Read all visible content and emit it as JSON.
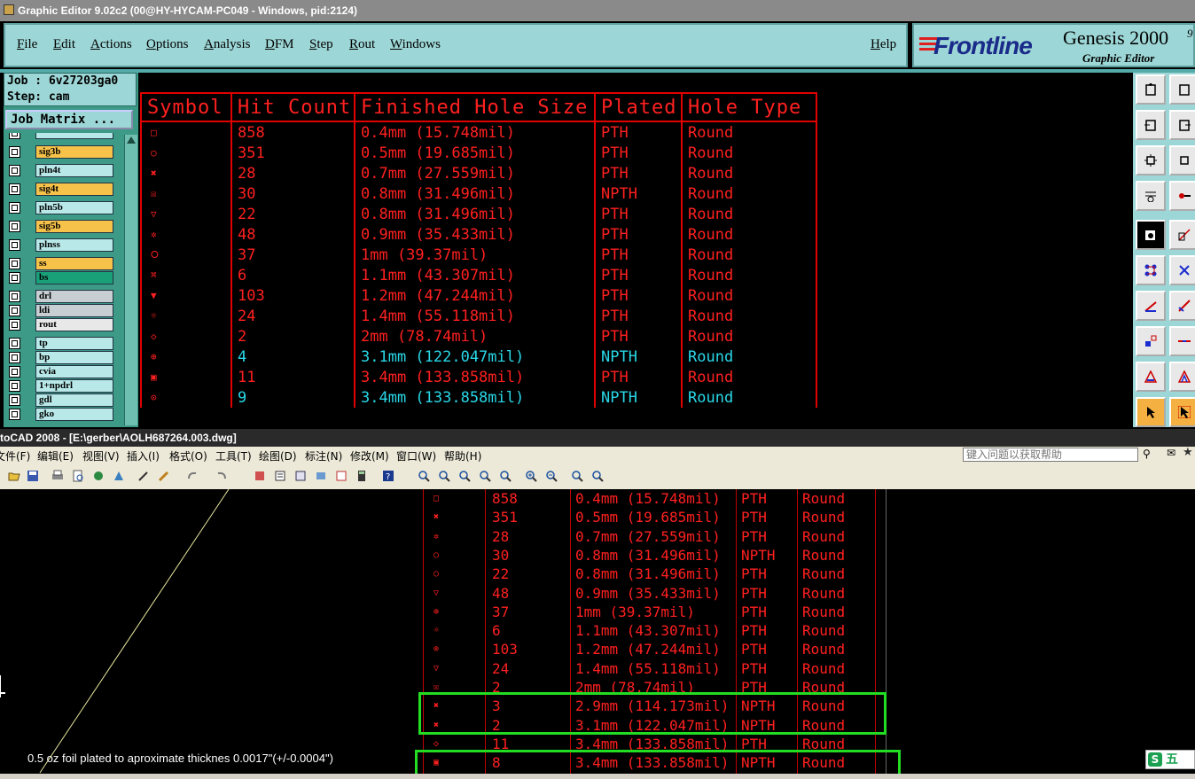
{
  "genesis": {
    "title": "Graphic Editor 9.02c2 (00@HY-HYCAM-PC049 - Windows, pid:2124)",
    "menu": [
      "File",
      "Edit",
      "Actions",
      "Options",
      "Analysis",
      "DFM",
      "Step",
      "Rout",
      "Windows"
    ],
    "help": "Help",
    "brand": {
      "logo": "Frontline",
      "product": "Genesis 2000",
      "version_fragment": "9",
      "subtitle": "Graphic Editor"
    },
    "job": "Job : 6v27203ga0",
    "step": "Step: cam",
    "job_matrix": "Job Matrix ...",
    "layers": [
      {
        "name": "",
        "color": "#b8e8e8"
      },
      {
        "name": "sig3b",
        "color": "#f6c24a"
      },
      {
        "name": "pln4t",
        "color": "#b8e8e8"
      },
      {
        "name": "sig4t",
        "color": "#f6c24a"
      },
      {
        "name": "pln5b",
        "color": "#b8e8e8"
      },
      {
        "name": "sig5b",
        "color": "#f6c24a"
      },
      {
        "name": "plnss",
        "color": "#b8e8e8"
      },
      {
        "name": "ss",
        "color": "#f6c24a"
      },
      {
        "name": "bs",
        "color": "#1aa078"
      },
      {
        "name": "drl",
        "color": "#c8cfd2"
      },
      {
        "name": "ldi",
        "color": "#c8cfd2"
      },
      {
        "name": "rout",
        "color": "#e8e8e8"
      },
      {
        "name": "tp",
        "color": "#b8e8e8"
      },
      {
        "name": "bp",
        "color": "#b8e8e8"
      },
      {
        "name": "cvia",
        "color": "#b8e8e8"
      },
      {
        "name": "1+npdrl",
        "color": "#b8e8e8"
      },
      {
        "name": "gdl",
        "color": "#b8e8e8"
      },
      {
        "name": "gko",
        "color": "#b8e8e8"
      }
    ],
    "table": {
      "headers": [
        "Symbol",
        "Hit Count",
        "Finished Hole Size",
        "Plated",
        "Hole Type"
      ],
      "rows": [
        {
          "sym": "□",
          "count": "858",
          "size": "0.4mm (15.748mil)",
          "plated": "PTH",
          "type": "Round",
          "cyan": false
        },
        {
          "sym": "○",
          "count": "351",
          "size": "0.5mm (19.685mil)",
          "plated": "PTH",
          "type": "Round",
          "cyan": false
        },
        {
          "sym": "✖",
          "count": "28",
          "size": "0.7mm (27.559mil)",
          "plated": "PTH",
          "type": "Round",
          "cyan": false
        },
        {
          "sym": "☒",
          "count": "30",
          "size": "0.8mm (31.496mil)",
          "plated": "NPTH",
          "type": "Round",
          "cyan": false
        },
        {
          "sym": "▽",
          "count": "22",
          "size": "0.8mm (31.496mil)",
          "plated": "PTH",
          "type": "Round",
          "cyan": false
        },
        {
          "sym": "✲",
          "count": "48",
          "size": "0.9mm (35.433mil)",
          "plated": "PTH",
          "type": "Round",
          "cyan": false
        },
        {
          "sym": "⭘",
          "count": "37",
          "size": "1mm (39.37mil)",
          "plated": "PTH",
          "type": "Round",
          "cyan": false
        },
        {
          "sym": "⌘",
          "count": "6",
          "size": "1.1mm (43.307mil)",
          "plated": "PTH",
          "type": "Round",
          "cyan": false
        },
        {
          "sym": "▼",
          "count": "103",
          "size": "1.2mm (47.244mil)",
          "plated": "PTH",
          "type": "Round",
          "cyan": false
        },
        {
          "sym": "☼",
          "count": "24",
          "size": "1.4mm (55.118mil)",
          "plated": "PTH",
          "type": "Round",
          "cyan": false
        },
        {
          "sym": "◇",
          "count": "2",
          "size": "2mm (78.74mil)",
          "plated": "PTH",
          "type": "Round",
          "cyan": false
        },
        {
          "sym": "⊕",
          "count": "4",
          "size": "3.1mm (122.047mil)",
          "plated": "NPTH",
          "type": "Round",
          "cyan": true
        },
        {
          "sym": "▣",
          "count": "11",
          "size": "3.4mm (133.858mil)",
          "plated": "PTH",
          "type": "Round",
          "cyan": false
        },
        {
          "sym": "⊙",
          "count": "9",
          "size": "3.4mm (133.858mil)",
          "plated": "NPTH",
          "type": "Round",
          "cyan": true
        }
      ]
    }
  },
  "autocad": {
    "title": "toCAD 2008 - [E:\\gerber\\AOLH687264.003.dwg]",
    "menu": [
      "文件(F)",
      "编辑(E)",
      "视图(V)",
      "插入(I)",
      "格式(O)",
      "工具(T)",
      "绘图(D)",
      "标注(N)",
      "修改(M)",
      "窗口(W)",
      "帮助(H)"
    ],
    "help_placeholder": "键入问题以获取帮助",
    "table_rows": [
      {
        "sym": "□",
        "count": "858",
        "size": "0.4mm (15.748mil)",
        "plated": "PTH",
        "type": "Round"
      },
      {
        "sym": "✖",
        "count": "351",
        "size": "0.5mm (19.685mil)",
        "plated": "PTH",
        "type": "Round"
      },
      {
        "sym": "✲",
        "count": "28",
        "size": "0.7mm (27.559mil)",
        "plated": "PTH",
        "type": "Round"
      },
      {
        "sym": "○",
        "count": "30",
        "size": "0.8mm (31.496mil)",
        "plated": "NPTH",
        "type": "Round"
      },
      {
        "sym": "○",
        "count": "22",
        "size": "0.8mm (31.496mil)",
        "plated": "PTH",
        "type": "Round"
      },
      {
        "sym": "▽",
        "count": "48",
        "size": "0.9mm (35.433mil)",
        "plated": "PTH",
        "type": "Round"
      },
      {
        "sym": "⊕",
        "count": "37",
        "size": "1mm (39.37mil)",
        "plated": "PTH",
        "type": "Round"
      },
      {
        "sym": "☼",
        "count": "6",
        "size": "1.1mm (43.307mil)",
        "plated": "PTH",
        "type": "Round"
      },
      {
        "sym": "⊚",
        "count": "103",
        "size": "1.2mm (47.244mil)",
        "plated": "PTH",
        "type": "Round"
      },
      {
        "sym": "▽",
        "count": "24",
        "size": "1.4mm (55.118mil)",
        "plated": "PTH",
        "type": "Round"
      },
      {
        "sym": "☒",
        "count": "2",
        "size": "2mm (78.74mil)",
        "plated": "PTH",
        "type": "Round"
      },
      {
        "sym": "✖",
        "count": "3",
        "size": "2.9mm (114.173mil)",
        "plated": "NPTH",
        "type": "Round"
      },
      {
        "sym": "✖",
        "count": "2",
        "size": "3.1mm (122.047mil)",
        "plated": "NPTH",
        "type": "Round"
      },
      {
        "sym": "◇",
        "count": "11",
        "size": "3.4mm (133.858mil)",
        "plated": "PTH",
        "type": "Round"
      },
      {
        "sym": "▣",
        "count": "8",
        "size": "3.4mm (133.858mil)",
        "plated": "NPTH",
        "type": "Round"
      }
    ],
    "note": "0.5 oz foil plated to aproximate thicknes 0.0017\"(+/-0.0004\")",
    "ime": "五",
    "highlight_color": "#22dd22"
  }
}
